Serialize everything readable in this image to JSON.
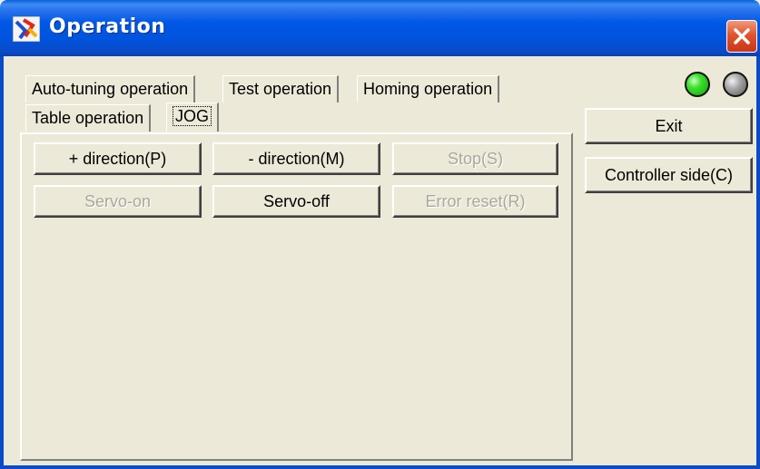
{
  "window": {
    "title": "Operation",
    "accent_color": "#0058e6",
    "close_button": {
      "icon": "close-icon"
    }
  },
  "tabs": {
    "row1": [
      {
        "label": "Auto-tuning operation"
      },
      {
        "label": "Test operation"
      },
      {
        "label": "Homing operation"
      }
    ],
    "row2": [
      {
        "label": "Table operation"
      },
      {
        "label": "JOG",
        "active": true
      }
    ]
  },
  "status_lamps": [
    {
      "name": "status-lamp-green",
      "color": "#3de02e",
      "state": "on"
    },
    {
      "name": "status-lamp-gray",
      "color": "#a5a5a5",
      "state": "off"
    }
  ],
  "jog_panel": {
    "buttons": [
      {
        "label": "+ direction(P)",
        "enabled": true
      },
      {
        "label": "- direction(M)",
        "enabled": true
      },
      {
        "label": "Stop(S)",
        "enabled": false
      },
      {
        "label": "Servo-on",
        "enabled": false
      },
      {
        "label": "Servo-off",
        "enabled": true
      },
      {
        "label": "Error reset(R)",
        "enabled": false
      }
    ]
  },
  "side_buttons": {
    "exit": "Exit",
    "controller_side": "Controller side(C)"
  }
}
